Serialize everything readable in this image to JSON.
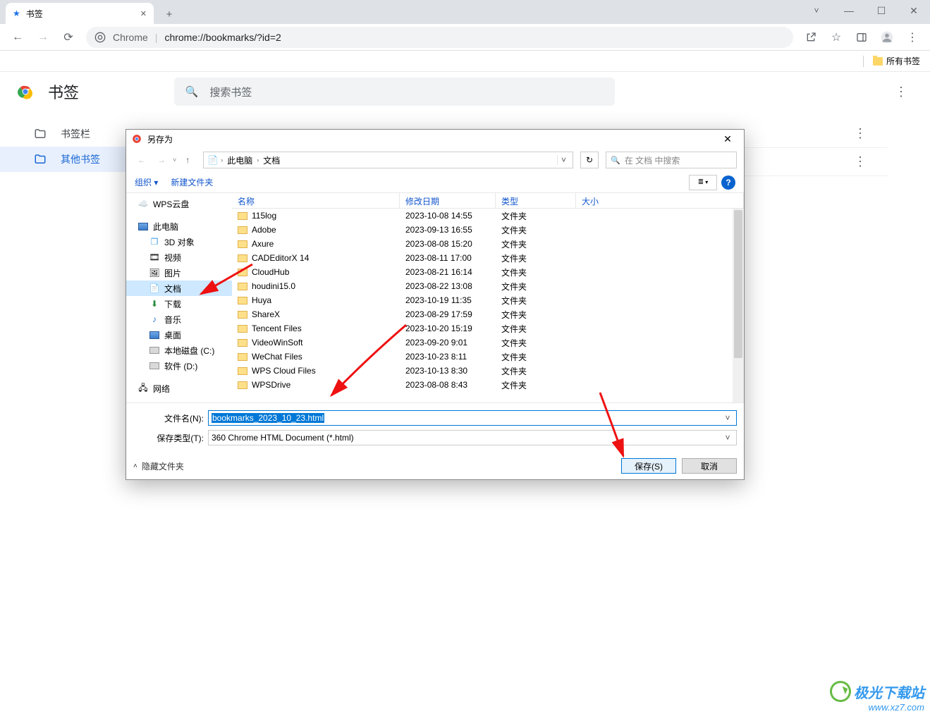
{
  "window": {
    "minimize": "—",
    "maximize": "☐",
    "close": "✕",
    "chevron": "˅"
  },
  "tab": {
    "title": "书签"
  },
  "newTab": "+",
  "nav": {
    "back": "←",
    "forward": "→",
    "reload": "⟳"
  },
  "omnibox": {
    "chromeLabel": "Chrome",
    "separator": "|",
    "url": "chrome://bookmarks/?id=2"
  },
  "toolbarIcons": {
    "share": "↗",
    "star": "☆",
    "sidepanel": "▣",
    "profile": "👤",
    "menu": "⋮"
  },
  "bookmarksBar": {
    "allBookmarks": "所有书签"
  },
  "bm": {
    "title": "书签",
    "searchPlaceholder": "搜索书签",
    "menu": "⋮",
    "sidebar": {
      "item0": "书签栏",
      "item1": "其他书签"
    }
  },
  "dialog": {
    "title": "另存为",
    "close": "✕",
    "nav": {
      "back": "←",
      "forward": "→",
      "up": "↑"
    },
    "path": {
      "crumb1": "此电脑",
      "crumb2": "文档",
      "chev": "›",
      "dd": "˅"
    },
    "refresh": "↻",
    "search": {
      "icon": "🔍",
      "placeholder": "在 文档 中搜索"
    },
    "toolbar": {
      "organize": "组织 ▾",
      "newfolder": "新建文件夹",
      "viewLabel": "≡"
    },
    "help": "?",
    "tree": {
      "wps": "WPS云盘",
      "pc": "此电脑",
      "obj3d": "3D 对象",
      "video": "视频",
      "pictures": "图片",
      "docs": "文档",
      "downloads": "下载",
      "music": "音乐",
      "desktop": "桌面",
      "driveC": "本地磁盘 (C:)",
      "driveD": "软件 (D:)",
      "network": "网络"
    },
    "cols": {
      "name": "名称",
      "date": "修改日期",
      "type": "类型",
      "size": "大小"
    },
    "files": [
      {
        "name": "115log",
        "date": "2023-10-08 14:55",
        "type": "文件夹"
      },
      {
        "name": "Adobe",
        "date": "2023-09-13 16:55",
        "type": "文件夹"
      },
      {
        "name": "Axure",
        "date": "2023-08-08 15:20",
        "type": "文件夹"
      },
      {
        "name": "CADEditorX 14",
        "date": "2023-08-11 17:00",
        "type": "文件夹"
      },
      {
        "name": "CloudHub",
        "date": "2023-08-21 16:14",
        "type": "文件夹"
      },
      {
        "name": "houdini15.0",
        "date": "2023-08-22 13:08",
        "type": "文件夹"
      },
      {
        "name": "Huya",
        "date": "2023-10-19 11:35",
        "type": "文件夹"
      },
      {
        "name": "ShareX",
        "date": "2023-08-29 17:59",
        "type": "文件夹"
      },
      {
        "name": "Tencent Files",
        "date": "2023-10-20 15:19",
        "type": "文件夹"
      },
      {
        "name": "VideoWinSoft",
        "date": "2023-09-20 9:01",
        "type": "文件夹"
      },
      {
        "name": "WeChat Files",
        "date": "2023-10-23 8:11",
        "type": "文件夹"
      },
      {
        "name": "WPS Cloud Files",
        "date": "2023-10-13 8:30",
        "type": "文件夹"
      },
      {
        "name": "WPSDrive",
        "date": "2023-08-08 8:43",
        "type": "文件夹"
      }
    ],
    "fields": {
      "filenameLabel": "文件名(N):",
      "filenameValue": "bookmarks_2023_10_23.html",
      "typeLabel": "保存类型(T):",
      "typeValue": "360 Chrome HTML Document (*.html)"
    },
    "hideFolders": "隐藏文件夹",
    "save": "保存(S)",
    "cancel": "取消"
  },
  "watermark": {
    "line1": "极光下载站",
    "line2": "www.xz7.com"
  }
}
